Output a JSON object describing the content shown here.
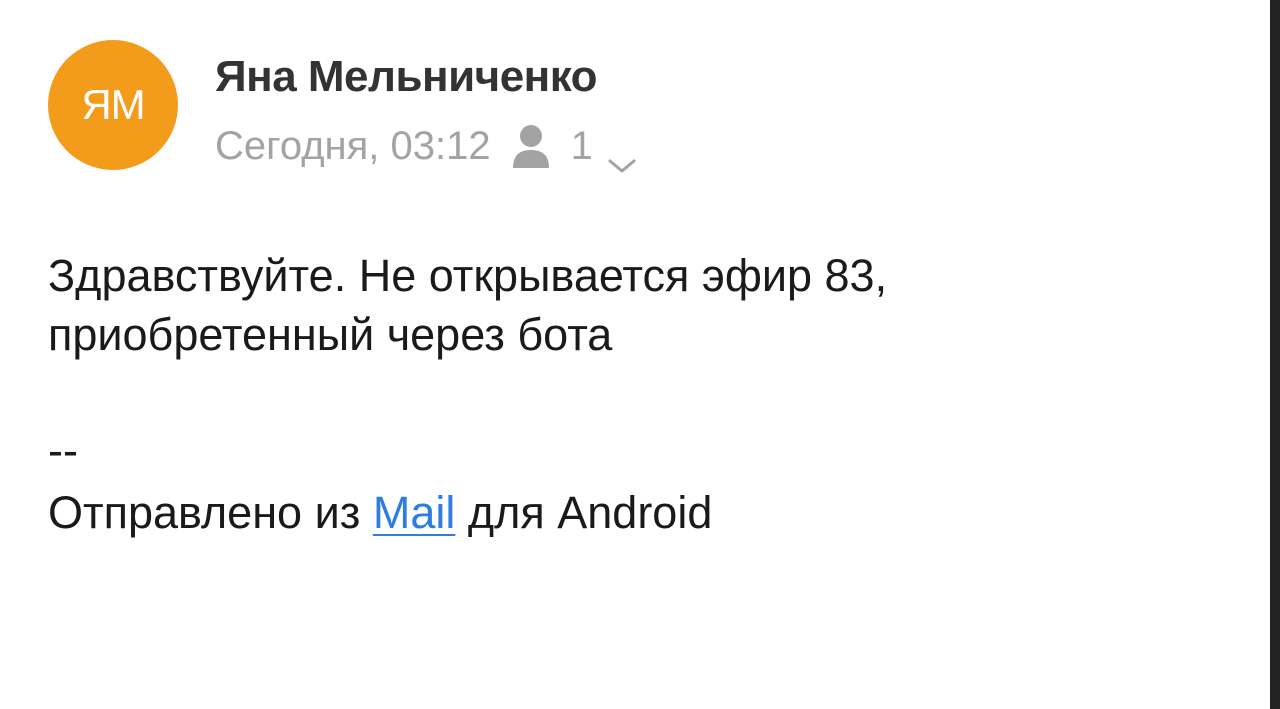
{
  "sender": {
    "initials": "ЯМ",
    "name": "Яна Мельниченко",
    "avatar_color": "#f39c1c"
  },
  "meta": {
    "date": "Сегодня, 03:12",
    "recipients_icon": "person-icon",
    "recipients_count": "1",
    "expand_icon": "chevron-down-icon"
  },
  "message": {
    "body_lines": [
      "Здравствуйте. Не открывается эфир 83,",
      "приобретенный через бота"
    ],
    "signature_separator": "--",
    "signature_prefix": "Отправлено из ",
    "signature_link": "Mail",
    "signature_suffix": " для Android"
  },
  "colors": {
    "link": "#2f7de1",
    "meta_text": "#a3a3a3",
    "name_text": "#333333"
  }
}
